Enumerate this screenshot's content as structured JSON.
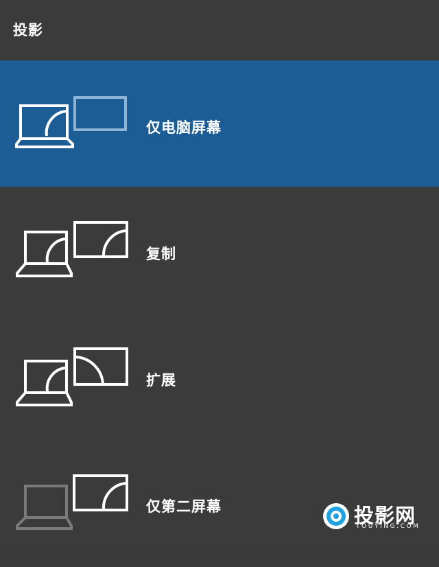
{
  "header": {
    "title": "投影"
  },
  "options": [
    {
      "label": "仅电脑屏幕",
      "icon": "pc-screen-only-icon",
      "selected": true
    },
    {
      "label": "复制",
      "icon": "duplicate-icon",
      "selected": false
    },
    {
      "label": "扩展",
      "icon": "extend-icon",
      "selected": false
    },
    {
      "label": "仅第二屏幕",
      "icon": "second-screen-only-icon",
      "selected": false
    }
  ],
  "colors": {
    "background": "#3b3b3b",
    "selected": "#1c5d96",
    "watermark_accent": "#1fa3e0"
  },
  "watermark": {
    "text": "投影网",
    "subtext": "TOUYING.COM"
  }
}
